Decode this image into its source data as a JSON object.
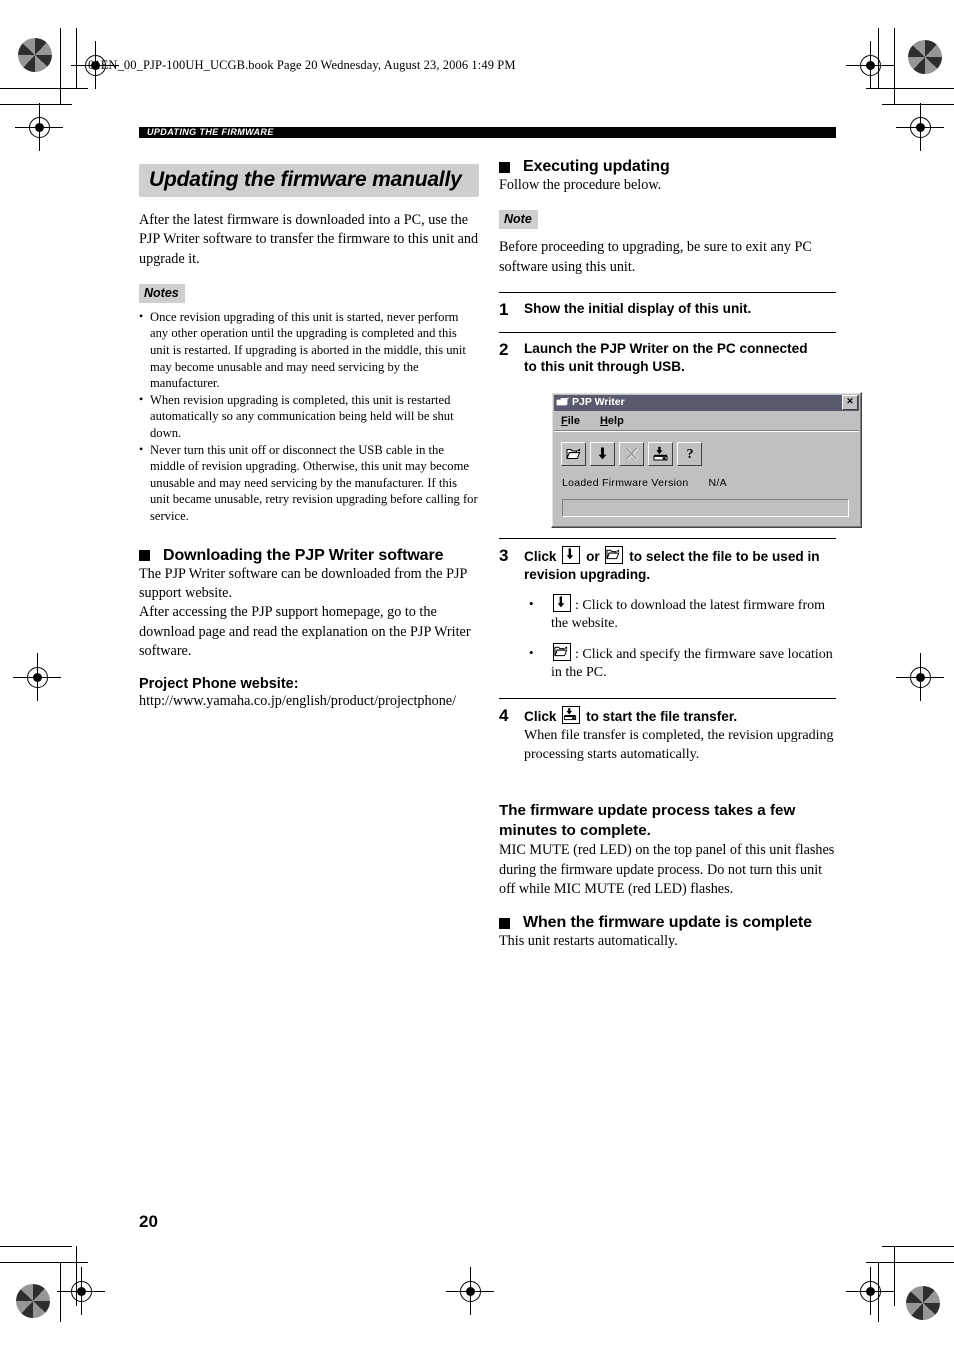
{
  "print": {
    "filename_header": "01EN_00_PJP-100UH_UCGB.book  Page 20  Wednesday, August 23, 2006  1:49 PM",
    "page_number": "20"
  },
  "running_head": {
    "label": "UPDATING THE FIRMWARE"
  },
  "left_column": {
    "chapter_title": "Updating the firmware manually",
    "intro": "After the latest firmware is downloaded into a PC, use the PJP Writer software to transfer the firmware to this unit and upgrade it.",
    "notes_label": "Notes",
    "notes": [
      "Once revision upgrading of this unit is started, never perform any other operation until the upgrading is completed and this unit is restarted. If upgrading is aborted in the middle, this unit may become unusable and may need servicing by the manufacturer.",
      "When revision upgrading is completed, this unit is restarted automatically so any communication being held will be shut down.",
      "Never turn this unit off or disconnect the USB cable in the middle of revision upgrading. Otherwise, this unit may become unusable and may need servicing by the manufacturer. If this unit became unusable, retry revision upgrading before calling for service."
    ],
    "download_heading": "Downloading the PJP Writer software",
    "download_body_1": "The PJP Writer software can be downloaded from the PJP support website.",
    "download_body_2": "After accessing the PJP support homepage, go to the download page and read the explanation on the PJP Writer software.",
    "website_heading": "Project Phone website:",
    "website_url": "http://www.yamaha.co.jp/english/product/projectphone/"
  },
  "right_column": {
    "executing_heading": "Executing updating",
    "executing_body": "Follow the procedure below.",
    "note_label": "Note",
    "note_body": "Before proceeding to upgrading, be sure to exit any PC software using this unit.",
    "steps": [
      {
        "number": "1",
        "title": "Show the initial display of this unit."
      },
      {
        "number": "2",
        "title_line_1": "Launch the PJP Writer on the PC connected",
        "title_line_2": "to this unit through USB."
      },
      {
        "number": "3",
        "title_part_1": "Click",
        "title_part_2": "or",
        "title_part_3": "to select the file to be used in revision upgrading.",
        "bullets": [
          ": Click to download the latest firmware from the website.",
          ": Click and specify the firmware save location in the PC."
        ]
      },
      {
        "number": "4",
        "title_part_1": "Click",
        "title_part_2": "to start the file transfer.",
        "desc": "When file transfer is completed, the revision upgrading processing starts automatically."
      }
    ],
    "process_heading_line_1": "The firmware update process takes a few",
    "process_heading_line_2": "minutes to complete.",
    "process_body": "MIC MUTE (red LED) on the top panel of this unit flashes during the firmware update process. Do not turn this unit off while MIC MUTE (red LED) flashes.",
    "complete_heading": "When the firmware update is complete",
    "complete_body": "This unit restarts automatically."
  },
  "dialog": {
    "title": "PJP Writer",
    "close_label": "✕",
    "menus": [
      {
        "prefix": "F",
        "rest": "ile"
      },
      {
        "prefix": "H",
        "rest": "elp"
      }
    ],
    "toolbar_buttons": [
      "open-folder-icon",
      "download-arrow-icon",
      "cancel-x-icon",
      "transfer-to-device-icon",
      "help-question-icon"
    ],
    "status_label": "Loaded Firmware Version",
    "status_value": "N/A",
    "progress_value": ""
  },
  "colors": {
    "running_head_bg": "#000000",
    "band_gray": "#cfcfcf",
    "dialog_face": "#c0c0c0",
    "titlebar": "#5a5a6e"
  }
}
